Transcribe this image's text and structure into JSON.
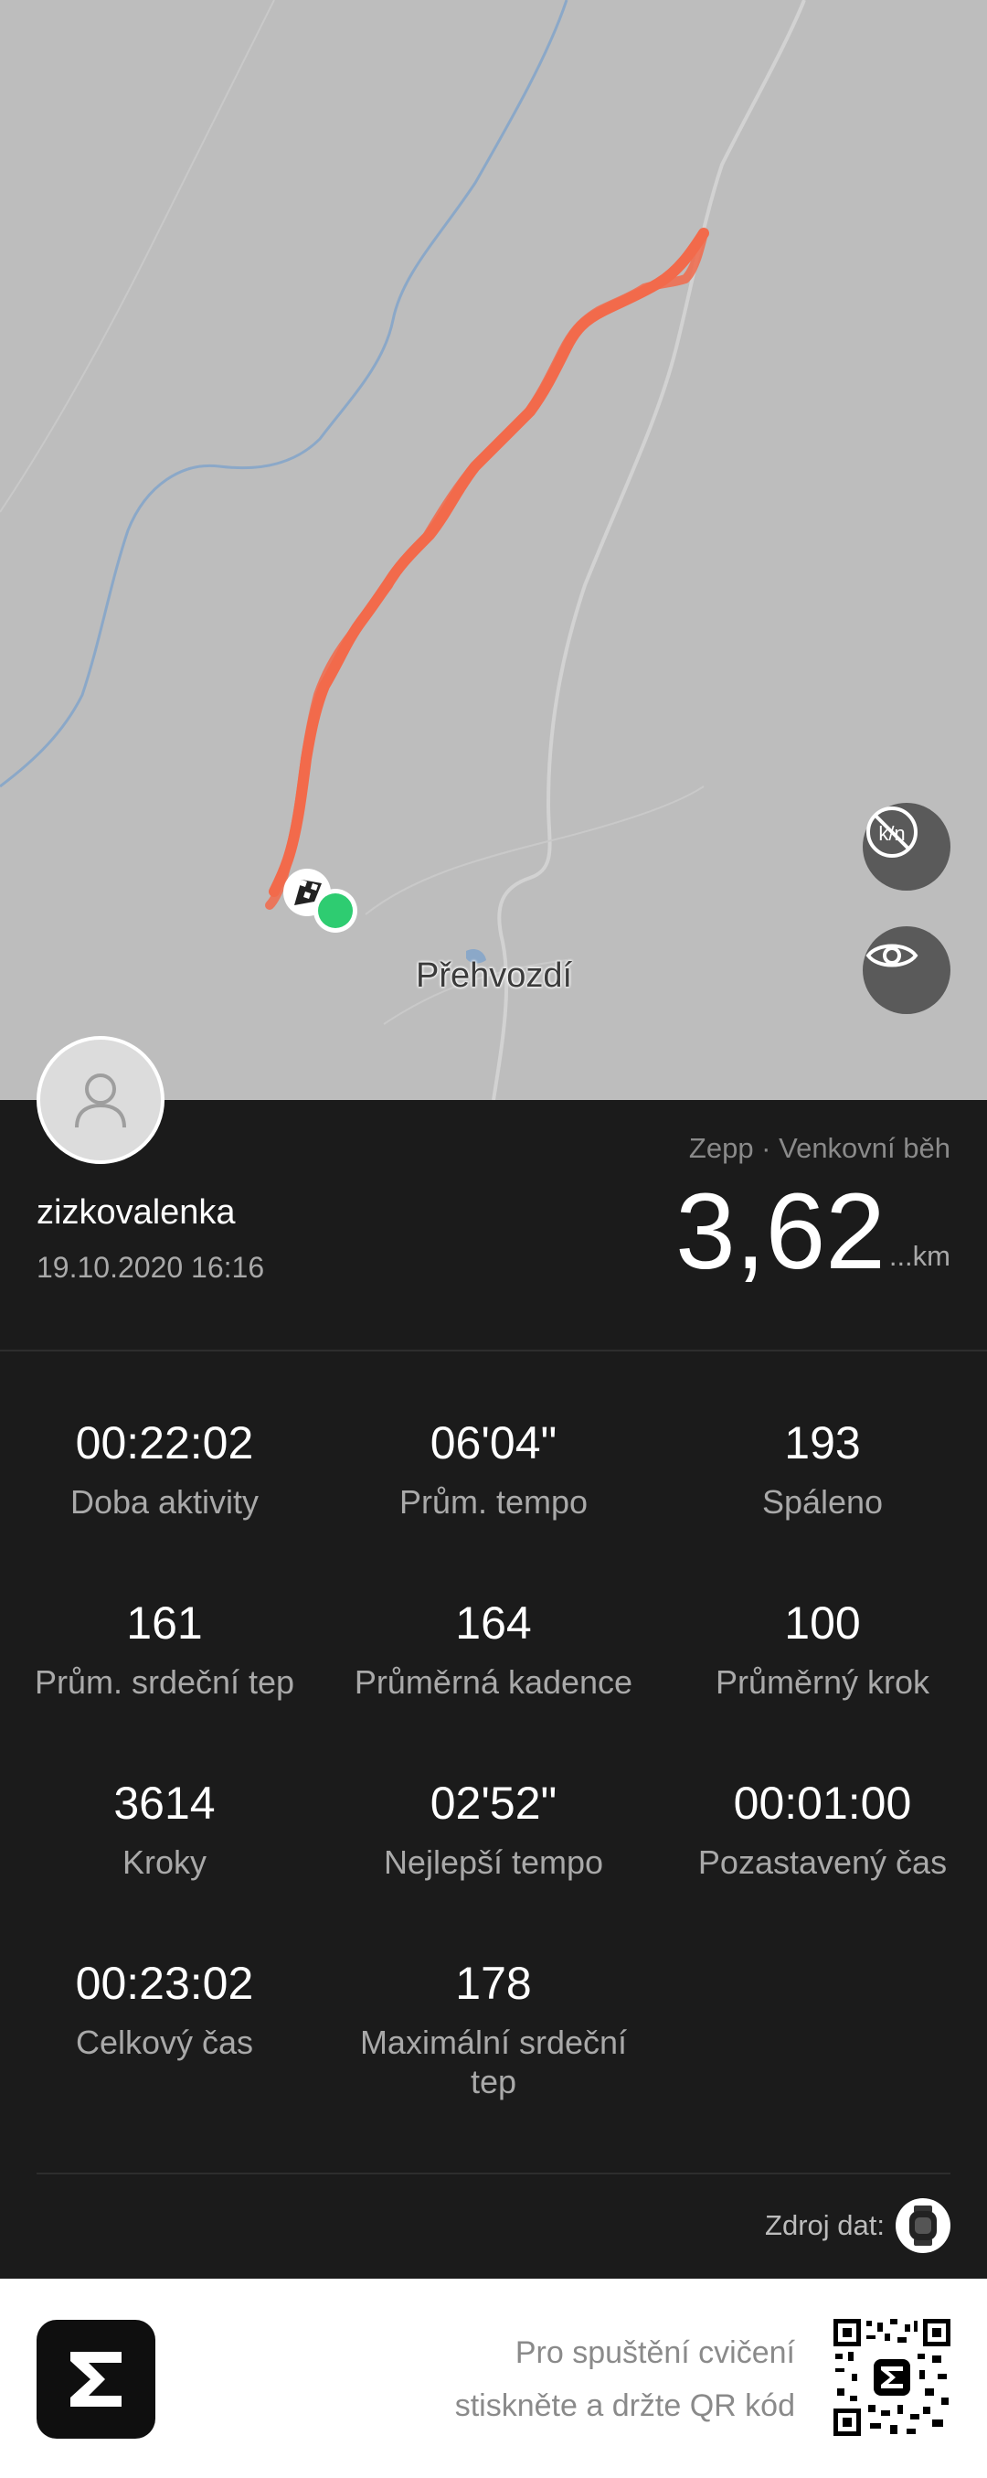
{
  "map": {
    "place_label": "Přehvozdí",
    "route_color": "#f26a4b",
    "start_marker_color": "#2ecc71",
    "buttons": [
      {
        "name": "km-off-icon"
      },
      {
        "name": "eye-icon"
      }
    ]
  },
  "workout": {
    "username": "zizkovalenka",
    "datetime": "19.10.2020 16:16",
    "source": "Zepp · Venkovní běh",
    "distance": "3,62",
    "unit": "...km"
  },
  "stats": [
    {
      "value": "00:22:02",
      "label": "Doba aktivity"
    },
    {
      "value": "06'04\"",
      "label": "Prům. tempo"
    },
    {
      "value": "193",
      "label": "Spáleno"
    },
    {
      "value": "161",
      "label": "Prům. srdeční tep"
    },
    {
      "value": "164",
      "label": "Průměrná kadence"
    },
    {
      "value": "100",
      "label": "Průměrný krok"
    },
    {
      "value": "3614",
      "label": "Kroky"
    },
    {
      "value": "02'52\"",
      "label": "Nejlepší tempo"
    },
    {
      "value": "00:01:00",
      "label": "Pozastavený čas"
    },
    {
      "value": "00:23:02",
      "label": "Celkový čas"
    },
    {
      "value": "178",
      "label": "Maximální srdeční tep"
    }
  ],
  "data_source_label": "Zdroj dat:",
  "footer": {
    "line1": "Pro spuštění cvičení",
    "line2": "stiskněte a držte QR kód"
  }
}
